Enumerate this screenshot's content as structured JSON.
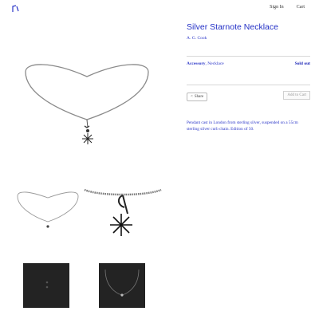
{
  "header": {
    "logo_icon": "musical-note-logo",
    "nav": [
      "Sign In",
      "Cart"
    ]
  },
  "product": {
    "title": "Silver Starnote Necklace",
    "artist": "A. G. Cook",
    "category_bold": "Accessory",
    "category_rest": ", Necklace",
    "status": "Sold out",
    "add_to_cart": "Add to Cart",
    "share": "Share",
    "description": "Pendant cast in London from sterling silver, suspended on a 55cm sterling silver curb chain. Edition of 50."
  },
  "colors": {
    "accent": "#2a35c8",
    "thumb_bg": "#232323"
  }
}
